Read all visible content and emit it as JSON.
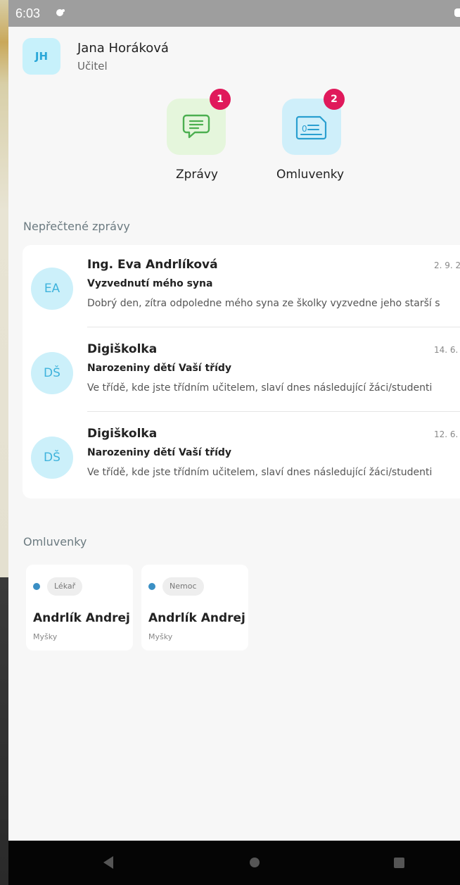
{
  "status": {
    "time": "6:03"
  },
  "profile": {
    "initials": "JH",
    "name": "Jana Horáková",
    "role": "Učitel"
  },
  "tiles": {
    "messages": {
      "label": "Zprávy",
      "badge": "1"
    },
    "excuses": {
      "label": "Omluvenky",
      "badge": "2"
    }
  },
  "unread": {
    "title": "Nepřečtené zprávy",
    "items": [
      {
        "initials": "EA",
        "sender": "Ing. Eva Andrlíková",
        "date": "2. 9. 2",
        "subject": "Vyzvednutí mého syna",
        "preview": "Dobrý den, zítra odpoledne mého syna ze školky vyzvedne jeho starší s"
      },
      {
        "initials": "DŠ",
        "sender": "Digiškolka",
        "date": "14. 6.",
        "subject": "Narozeniny dětí Vaší třídy",
        "preview": "Ve třídě, kde jste třídním učitelem, slaví dnes následující žáci/studenti"
      },
      {
        "initials": "DŠ",
        "sender": "Digiškolka",
        "date": "12. 6.",
        "subject": "Narozeniny dětí Vaší třídy",
        "preview": "Ve třídě, kde jste třídním učitelem, slaví dnes následující žáci/studenti"
      }
    ]
  },
  "excuses": {
    "title": "Omluvenky",
    "items": [
      {
        "reason": "Lékař",
        "name": "Andrlík Andrej",
        "class": "Myšky"
      },
      {
        "reason": "Nemoc",
        "name": "Andrlík Andrej",
        "class": "Myšky"
      }
    ]
  },
  "colors": {
    "accent": "#2aa7d8",
    "badge": "#e0195b",
    "messages_tile": "#e5f6dc",
    "excuses_tile": "#cfeffa",
    "excuse_dot": "#3a8fc4"
  }
}
